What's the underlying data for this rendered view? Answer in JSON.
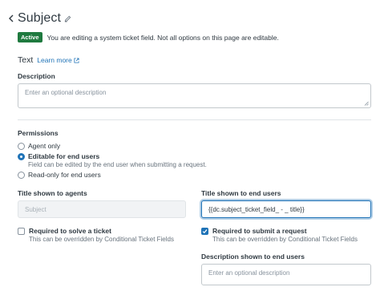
{
  "header": {
    "title": "Subject"
  },
  "notice": {
    "badge": "Active",
    "text": "You are editing a system ticket field. Not all options on this page are editable."
  },
  "field_type": {
    "label": "Text",
    "learn_more": "Learn more"
  },
  "description": {
    "label": "Description",
    "placeholder": "Enter an optional description"
  },
  "permissions": {
    "label": "Permissions",
    "options": [
      {
        "label": "Agent only",
        "checked": false
      },
      {
        "label": "Editable for end users",
        "checked": true,
        "hint": "Field can be edited by the end user when submitting a request."
      },
      {
        "label": "Read-only for end users",
        "checked": false
      }
    ]
  },
  "agents": {
    "title_label": "Title shown to agents",
    "title_value": "Subject",
    "required_label": "Required to solve a ticket",
    "required_hint": "This can be overridden by Conditional Ticket Fields",
    "required_checked": false
  },
  "end_users": {
    "title_label": "Title shown to end users",
    "title_value": "{{dc.subject_ticket_field_ - _ title}}",
    "required_label": "Required to submit a request",
    "required_hint": "This can be overridden by Conditional Ticket Fields",
    "required_checked": true,
    "description_label": "Description shown to end users",
    "description_placeholder": "Enter an optional description"
  },
  "colors": {
    "accent": "#1f73b7",
    "active_badge": "#1f7a3f",
    "text": "#2f3941"
  }
}
